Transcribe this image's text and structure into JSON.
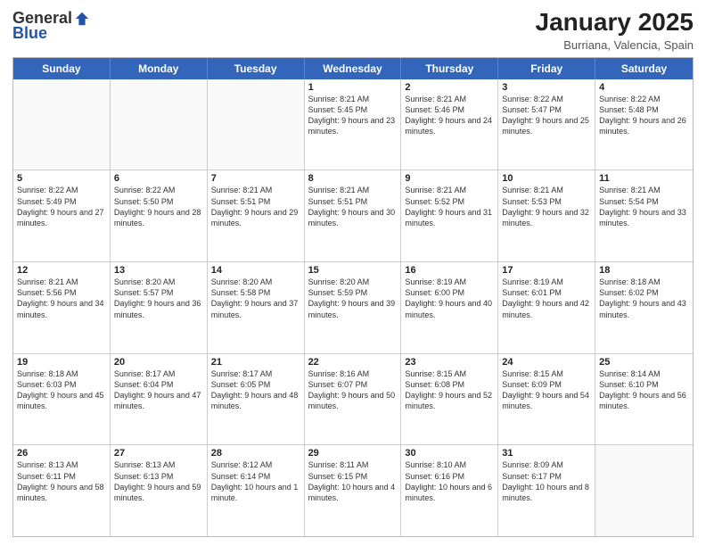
{
  "logo": {
    "general": "General",
    "blue": "Blue"
  },
  "title": "January 2025",
  "location": "Burriana, Valencia, Spain",
  "weekdays": [
    "Sunday",
    "Monday",
    "Tuesday",
    "Wednesday",
    "Thursday",
    "Friday",
    "Saturday"
  ],
  "rows": [
    [
      {
        "day": "",
        "info": ""
      },
      {
        "day": "",
        "info": ""
      },
      {
        "day": "",
        "info": ""
      },
      {
        "day": "1",
        "info": "Sunrise: 8:21 AM\nSunset: 5:45 PM\nDaylight: 9 hours\nand 23 minutes."
      },
      {
        "day": "2",
        "info": "Sunrise: 8:21 AM\nSunset: 5:46 PM\nDaylight: 9 hours\nand 24 minutes."
      },
      {
        "day": "3",
        "info": "Sunrise: 8:22 AM\nSunset: 5:47 PM\nDaylight: 9 hours\nand 25 minutes."
      },
      {
        "day": "4",
        "info": "Sunrise: 8:22 AM\nSunset: 5:48 PM\nDaylight: 9 hours\nand 26 minutes."
      }
    ],
    [
      {
        "day": "5",
        "info": "Sunrise: 8:22 AM\nSunset: 5:49 PM\nDaylight: 9 hours\nand 27 minutes."
      },
      {
        "day": "6",
        "info": "Sunrise: 8:22 AM\nSunset: 5:50 PM\nDaylight: 9 hours\nand 28 minutes."
      },
      {
        "day": "7",
        "info": "Sunrise: 8:21 AM\nSunset: 5:51 PM\nDaylight: 9 hours\nand 29 minutes."
      },
      {
        "day": "8",
        "info": "Sunrise: 8:21 AM\nSunset: 5:51 PM\nDaylight: 9 hours\nand 30 minutes."
      },
      {
        "day": "9",
        "info": "Sunrise: 8:21 AM\nSunset: 5:52 PM\nDaylight: 9 hours\nand 31 minutes."
      },
      {
        "day": "10",
        "info": "Sunrise: 8:21 AM\nSunset: 5:53 PM\nDaylight: 9 hours\nand 32 minutes."
      },
      {
        "day": "11",
        "info": "Sunrise: 8:21 AM\nSunset: 5:54 PM\nDaylight: 9 hours\nand 33 minutes."
      }
    ],
    [
      {
        "day": "12",
        "info": "Sunrise: 8:21 AM\nSunset: 5:56 PM\nDaylight: 9 hours\nand 34 minutes."
      },
      {
        "day": "13",
        "info": "Sunrise: 8:20 AM\nSunset: 5:57 PM\nDaylight: 9 hours\nand 36 minutes."
      },
      {
        "day": "14",
        "info": "Sunrise: 8:20 AM\nSunset: 5:58 PM\nDaylight: 9 hours\nand 37 minutes."
      },
      {
        "day": "15",
        "info": "Sunrise: 8:20 AM\nSunset: 5:59 PM\nDaylight: 9 hours\nand 39 minutes."
      },
      {
        "day": "16",
        "info": "Sunrise: 8:19 AM\nSunset: 6:00 PM\nDaylight: 9 hours\nand 40 minutes."
      },
      {
        "day": "17",
        "info": "Sunrise: 8:19 AM\nSunset: 6:01 PM\nDaylight: 9 hours\nand 42 minutes."
      },
      {
        "day": "18",
        "info": "Sunrise: 8:18 AM\nSunset: 6:02 PM\nDaylight: 9 hours\nand 43 minutes."
      }
    ],
    [
      {
        "day": "19",
        "info": "Sunrise: 8:18 AM\nSunset: 6:03 PM\nDaylight: 9 hours\nand 45 minutes."
      },
      {
        "day": "20",
        "info": "Sunrise: 8:17 AM\nSunset: 6:04 PM\nDaylight: 9 hours\nand 47 minutes."
      },
      {
        "day": "21",
        "info": "Sunrise: 8:17 AM\nSunset: 6:05 PM\nDaylight: 9 hours\nand 48 minutes."
      },
      {
        "day": "22",
        "info": "Sunrise: 8:16 AM\nSunset: 6:07 PM\nDaylight: 9 hours\nand 50 minutes."
      },
      {
        "day": "23",
        "info": "Sunrise: 8:15 AM\nSunset: 6:08 PM\nDaylight: 9 hours\nand 52 minutes."
      },
      {
        "day": "24",
        "info": "Sunrise: 8:15 AM\nSunset: 6:09 PM\nDaylight: 9 hours\nand 54 minutes."
      },
      {
        "day": "25",
        "info": "Sunrise: 8:14 AM\nSunset: 6:10 PM\nDaylight: 9 hours\nand 56 minutes."
      }
    ],
    [
      {
        "day": "26",
        "info": "Sunrise: 8:13 AM\nSunset: 6:11 PM\nDaylight: 9 hours\nand 58 minutes."
      },
      {
        "day": "27",
        "info": "Sunrise: 8:13 AM\nSunset: 6:13 PM\nDaylight: 9 hours\nand 59 minutes."
      },
      {
        "day": "28",
        "info": "Sunrise: 8:12 AM\nSunset: 6:14 PM\nDaylight: 10 hours\nand 1 minute."
      },
      {
        "day": "29",
        "info": "Sunrise: 8:11 AM\nSunset: 6:15 PM\nDaylight: 10 hours\nand 4 minutes."
      },
      {
        "day": "30",
        "info": "Sunrise: 8:10 AM\nSunset: 6:16 PM\nDaylight: 10 hours\nand 6 minutes."
      },
      {
        "day": "31",
        "info": "Sunrise: 8:09 AM\nSunset: 6:17 PM\nDaylight: 10 hours\nand 8 minutes."
      },
      {
        "day": "",
        "info": ""
      }
    ]
  ]
}
